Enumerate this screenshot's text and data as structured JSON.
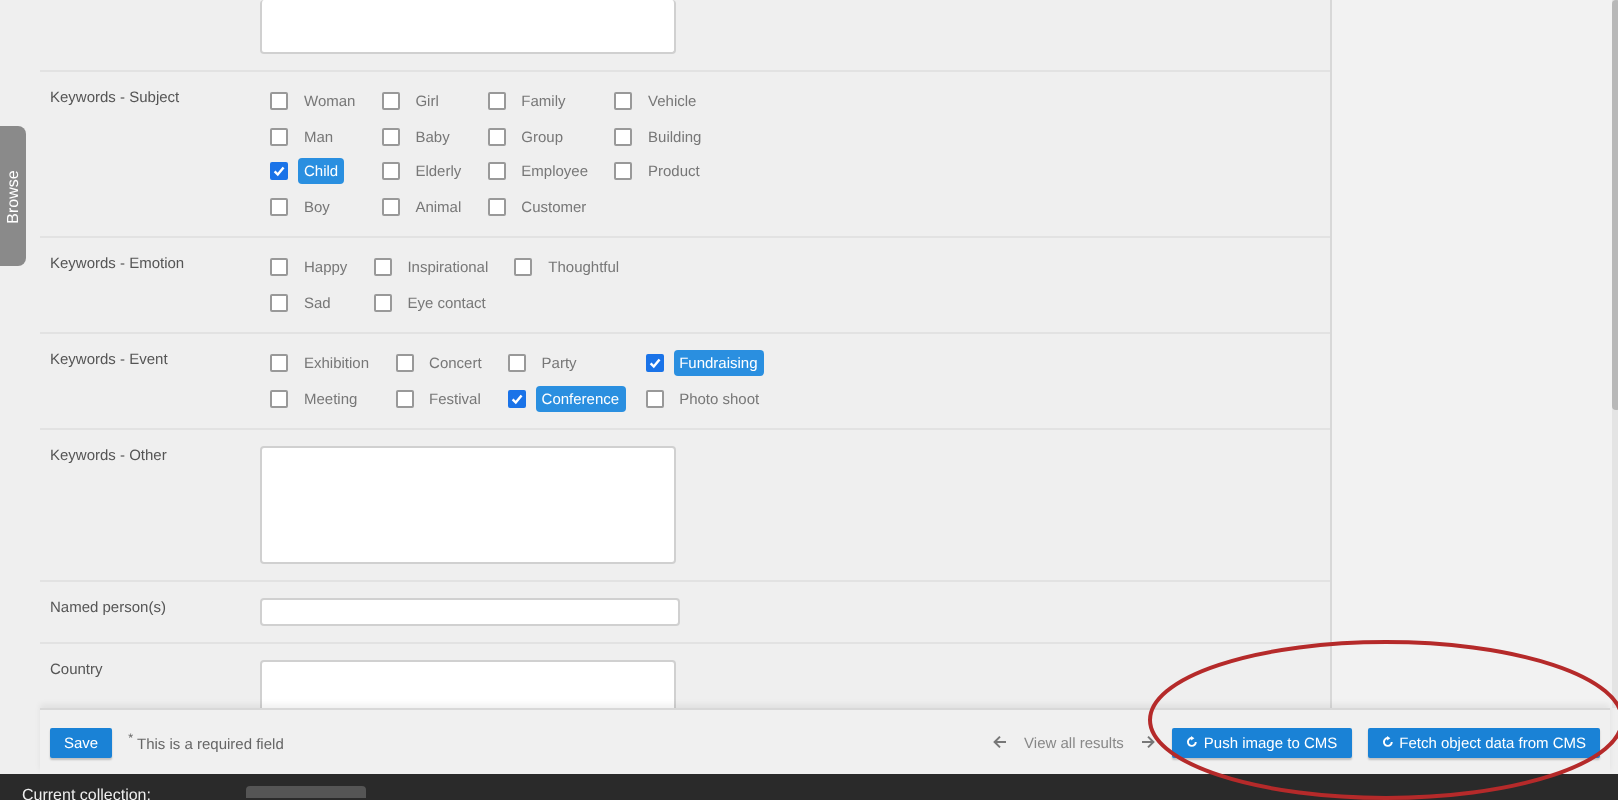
{
  "side_tab": {
    "label": "Browse"
  },
  "sections": [
    {
      "kind": "textarea"
    },
    {
      "kind": "checkboxes",
      "label": "Keywords - Subject",
      "rows": [
        [
          {
            "label": "Woman",
            "checked": false
          },
          {
            "label": "Girl",
            "checked": false
          },
          {
            "label": "Family",
            "checked": false
          },
          {
            "label": "Vehicle",
            "checked": false
          }
        ],
        [
          {
            "label": "Man",
            "checked": false
          },
          {
            "label": "Baby",
            "checked": false
          },
          {
            "label": "Group",
            "checked": false
          },
          {
            "label": "Building",
            "checked": false
          }
        ],
        [
          {
            "label": "Child",
            "checked": true
          },
          {
            "label": "Elderly",
            "checked": false
          },
          {
            "label": "Employee",
            "checked": false
          },
          {
            "label": "Product",
            "checked": false
          }
        ],
        [
          {
            "label": "Boy",
            "checked": false
          },
          {
            "label": "Animal",
            "checked": false
          },
          {
            "label": "Customer",
            "checked": false
          }
        ]
      ]
    },
    {
      "kind": "checkboxes",
      "label": "Keywords - Emotion",
      "rows": [
        [
          {
            "label": "Happy",
            "checked": false
          },
          {
            "label": "Inspirational",
            "checked": false
          },
          {
            "label": "Thoughtful",
            "checked": false
          }
        ],
        [
          {
            "label": "Sad",
            "checked": false
          },
          {
            "label": "Eye contact",
            "checked": false
          }
        ]
      ]
    },
    {
      "kind": "checkboxes",
      "label": "Keywords - Event",
      "rows": [
        [
          {
            "label": "Exhibition",
            "checked": false
          },
          {
            "label": "Concert",
            "checked": false
          },
          {
            "label": "Party",
            "checked": false
          },
          {
            "label": "Fundraising",
            "checked": true
          }
        ],
        [
          {
            "label": "Meeting",
            "checked": false
          },
          {
            "label": "Festival",
            "checked": false
          },
          {
            "label": "Conference",
            "checked": true
          },
          {
            "label": "Photo shoot",
            "checked": false
          }
        ]
      ]
    },
    {
      "kind": "textarea",
      "label": "Keywords - Other"
    },
    {
      "kind": "input",
      "label": "Named person(s)"
    },
    {
      "kind": "textarea",
      "label": "Country"
    }
  ],
  "footer": {
    "save": "Save",
    "required_note": "$^{*}$ This is a required field",
    "view_all": "View all results",
    "buttons": [
      "Push image to CMS",
      "Fetch object data from CMS"
    ]
  },
  "bottom_bar": {
    "label": "Current collection:"
  }
}
